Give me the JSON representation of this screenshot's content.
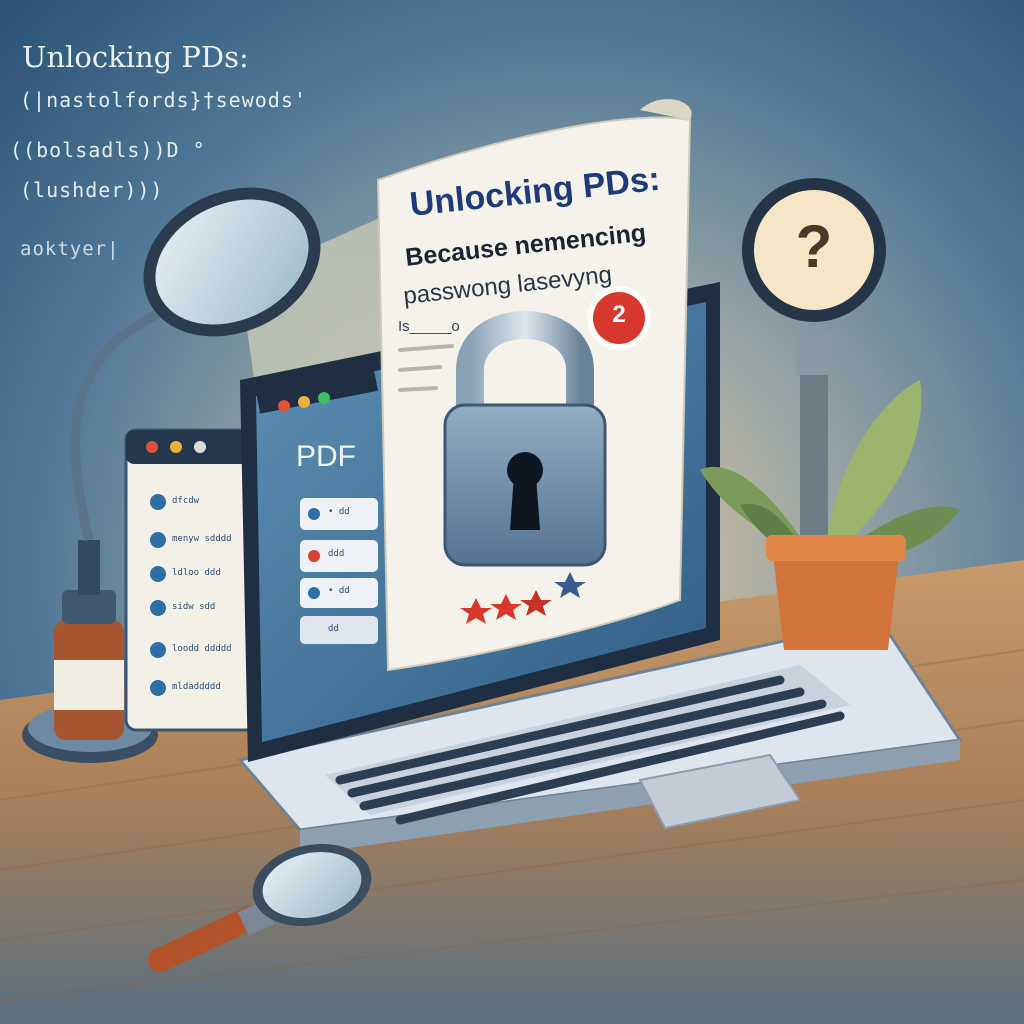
{
  "background_text": {
    "headline": "Unlocking PDs:",
    "code_lines": [
      "(|nastolfords}†sewods'",
      "((bolsadls))D  °",
      "(lushder)))",
      "aoktyer|"
    ]
  },
  "document": {
    "title": "Unlocking PDs:",
    "subtitle_line1": "Because nemencing",
    "subtitle_line2": "passwong lasevyng",
    "small_text": "Is_____o",
    "notification_count": "2"
  },
  "laptop_screen": {
    "title": "PDF",
    "menu_items": [
      "• dd",
      "ddd",
      "• dd",
      "dd"
    ]
  },
  "side_window": {
    "menu_items": [
      "dfcdw",
      "menyw sdddd",
      "ldloo ddd",
      "sidw sdd",
      "loodd ddddd",
      "mldaddddd"
    ]
  },
  "magnifier_sign": {
    "symbol": "?"
  },
  "colors": {
    "background": "#3f6a8a",
    "desk": "#b98a5b",
    "paper": "#f4f2ea",
    "accent_red": "#d8382c",
    "lock_body": "#6d8aa4",
    "plant_pot": "#d2733b"
  },
  "icons": [
    "lock-icon",
    "magnifying-glass-icon",
    "question-mark-icon",
    "notification-badge-icon",
    "plant-icon",
    "desk-lamp-icon",
    "star-icon"
  ]
}
